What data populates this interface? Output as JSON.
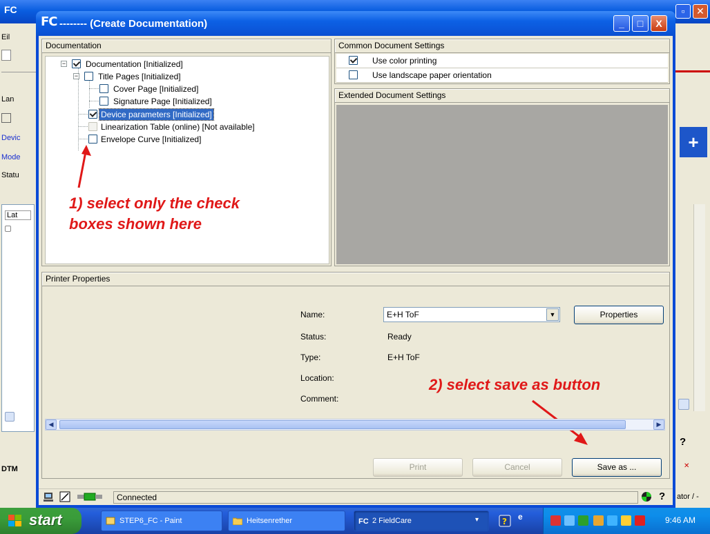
{
  "background_app": {
    "logo": "FC",
    "left_panel_labels": [
      "Eil",
      "Lan",
      "Devic",
      "Mode",
      "Statu",
      "Lat"
    ],
    "tab_label": "DTM",
    "right_status": "ator / -"
  },
  "dialog": {
    "logo": "FC",
    "title": "-------- (Create Documentation)",
    "window_buttons": {
      "minimize": "_",
      "maximize": "□",
      "close": "X"
    },
    "documentation": {
      "header": "Documentation",
      "tree": [
        {
          "label": "Documentation [Initialized]",
          "checked": true,
          "disabled": false
        },
        {
          "label": "Title Pages [Initialized]",
          "checked": false,
          "disabled": false
        },
        {
          "label": "Cover Page [Initialized]",
          "checked": false,
          "disabled": false
        },
        {
          "label": "Signature Page [Initialized]",
          "checked": false,
          "disabled": false
        },
        {
          "label": "Device parameters [Initialized]",
          "checked": true,
          "disabled": false,
          "selected": true
        },
        {
          "label": "Linearization Table (online) [Not available]",
          "checked": false,
          "disabled": true
        },
        {
          "label": "Envelope Curve [Initialized]",
          "checked": false,
          "disabled": false
        }
      ]
    },
    "common_settings": {
      "header": "Common Document Settings",
      "options": [
        {
          "label": "Use color printing",
          "checked": true
        },
        {
          "label": "Use landscape paper orientation",
          "checked": false
        }
      ]
    },
    "extended_settings": {
      "header": "Extended Document Settings"
    },
    "printer": {
      "header": "Printer Properties",
      "name_label": "Name:",
      "name_value": "E+H ToF",
      "properties_button": "Properties",
      "status_label": "Status:",
      "status_value": "Ready",
      "type_label": "Type:",
      "type_value": "E+H ToF",
      "location_label": "Location:",
      "comment_label": "Comment:"
    },
    "buttons": {
      "print": "Print",
      "cancel": "Cancel",
      "save_as": "Save as ..."
    },
    "status": "Connected"
  },
  "annotations": {
    "step1_line1": "1) select only the check",
    "step1_line2": "boxes shown here",
    "step2": "2) select save as button",
    "color": "#e01818"
  },
  "taskbar": {
    "start_label": "start",
    "items": [
      "STEP6_FC - Paint",
      "Heitsenrether",
      "2 FieldCare"
    ],
    "time": "9:46 AM"
  }
}
